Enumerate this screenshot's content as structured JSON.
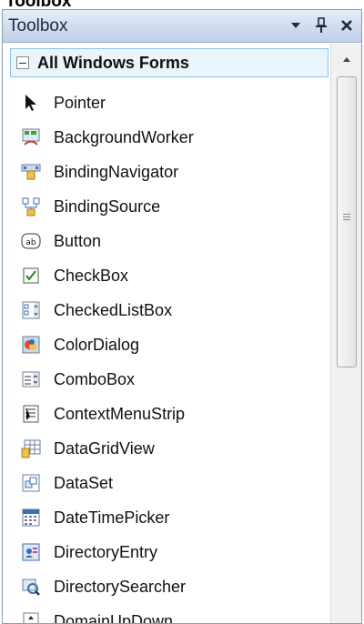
{
  "window": {
    "caption_above": "Toolbox",
    "title": "Toolbox"
  },
  "category": {
    "label": "All Windows Forms"
  },
  "items": [
    {
      "label": "Pointer",
      "icon": "pointer-icon"
    },
    {
      "label": "BackgroundWorker",
      "icon": "background-worker-icon"
    },
    {
      "label": "BindingNavigator",
      "icon": "binding-navigator-icon"
    },
    {
      "label": "BindingSource",
      "icon": "binding-source-icon"
    },
    {
      "label": "Button",
      "icon": "button-icon"
    },
    {
      "label": "CheckBox",
      "icon": "checkbox-icon"
    },
    {
      "label": "CheckedListBox",
      "icon": "checked-list-box-icon"
    },
    {
      "label": "ColorDialog",
      "icon": "color-dialog-icon"
    },
    {
      "label": "ComboBox",
      "icon": "combobox-icon"
    },
    {
      "label": "ContextMenuStrip",
      "icon": "context-menu-strip-icon"
    },
    {
      "label": "DataGridView",
      "icon": "data-grid-view-icon"
    },
    {
      "label": "DataSet",
      "icon": "dataset-icon"
    },
    {
      "label": "DateTimePicker",
      "icon": "date-time-picker-icon"
    },
    {
      "label": "DirectoryEntry",
      "icon": "directory-entry-icon"
    },
    {
      "label": "DirectorySearcher",
      "icon": "directory-searcher-icon"
    },
    {
      "label": "DomainUpDown",
      "icon": "domain-up-down-icon"
    }
  ],
  "colors": {
    "titlebar": "#cfdcef",
    "category_bg": "#eaf4fb",
    "category_border": "#8fc1e6"
  }
}
